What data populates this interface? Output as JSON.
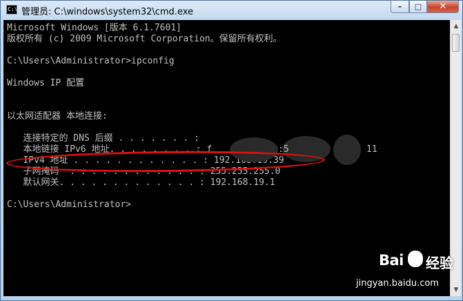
{
  "window": {
    "title": "管理员: C:\\windows\\system32\\cmd.exe",
    "icon_label": "C:\\"
  },
  "controls": {
    "minimize": "–",
    "maximize": "□",
    "close": "✕"
  },
  "console": {
    "lines": [
      "Microsoft Windows [版本 6.1.7601]",
      "版权所有 (c) 2009 Microsoft Corporation。保留所有权利。",
      "",
      "C:\\Users\\Administrator>ipconfig",
      "",
      "Windows IP 配置",
      "",
      "",
      "以太网适配器 本地连接:",
      "",
      "   连接特定的 DNS 后缀 . . . . . . . :",
      "   本地链接 IPv6 地址. . . . . . . . : f",
      "   IPv4 地址 . . . . . . . . . . . . : 192.168.19.39",
      "   子网掩码  . . . . . . . . . . . . : 255.255.255.0",
      "   默认网关. . . . . . . . . . . . . : 192.168.19.1",
      "",
      "C:\\Users\\Administrator>"
    ],
    "ipv6_fragment_1": ":5",
    "ipv6_fragment_2": "11",
    "text_color": "#c0c0c0",
    "background": "#000000",
    "highlight_color": "#e01010"
  },
  "watermark": {
    "brand": "Bai",
    "brand_suffix": "经验",
    "url": "jingyan.baidu.com"
  }
}
